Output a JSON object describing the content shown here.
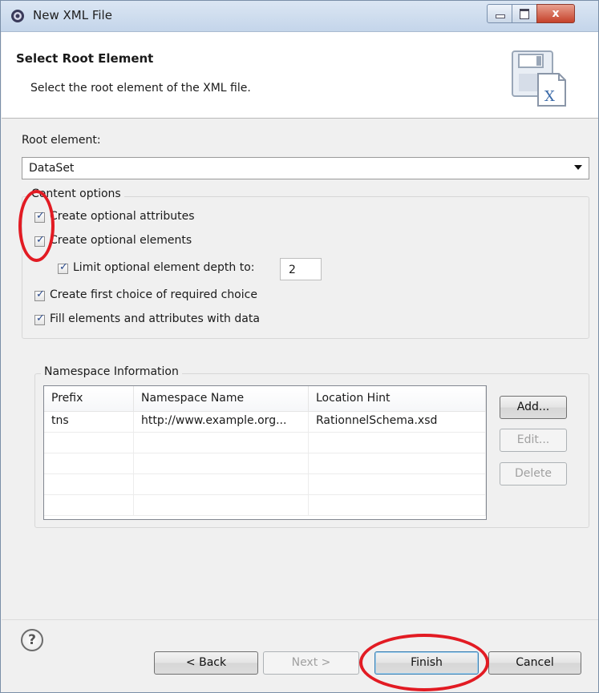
{
  "window": {
    "title": "New XML File",
    "controls": {
      "minimize": "",
      "maximize": "",
      "close": "x"
    }
  },
  "header": {
    "title": "Select Root Element",
    "description": "Select the root element of the XML file.",
    "icon": "xml-file-wizard-icon"
  },
  "root_element": {
    "label": "Root element:",
    "value": "DataSet"
  },
  "content_options": {
    "title": "Content options",
    "options": [
      {
        "label": "Create optional attributes",
        "checked": true
      },
      {
        "label": "Create optional elements",
        "checked": true
      },
      {
        "label": "Limit optional element depth to:",
        "checked": true
      },
      {
        "label": "Create first choice of required choice",
        "checked": true
      },
      {
        "label": "Fill elements and attributes with data",
        "checked": true
      }
    ],
    "depth_value": "2"
  },
  "namespace": {
    "title": "Namespace Information",
    "columns": [
      "Prefix",
      "Namespace Name",
      "Location Hint"
    ],
    "rows": [
      [
        "tns",
        "http://www.example.org...",
        "RationnelSchema.xsd"
      ]
    ],
    "buttons": {
      "add": "Add...",
      "edit": "Edit...",
      "delete": "Delete"
    }
  },
  "footer": {
    "help": "?",
    "back": "< Back",
    "next": "Next >",
    "finish": "Finish",
    "cancel": "Cancel"
  },
  "colors": {
    "annotation": "#e21b23",
    "accent": "#3c7fb1"
  }
}
